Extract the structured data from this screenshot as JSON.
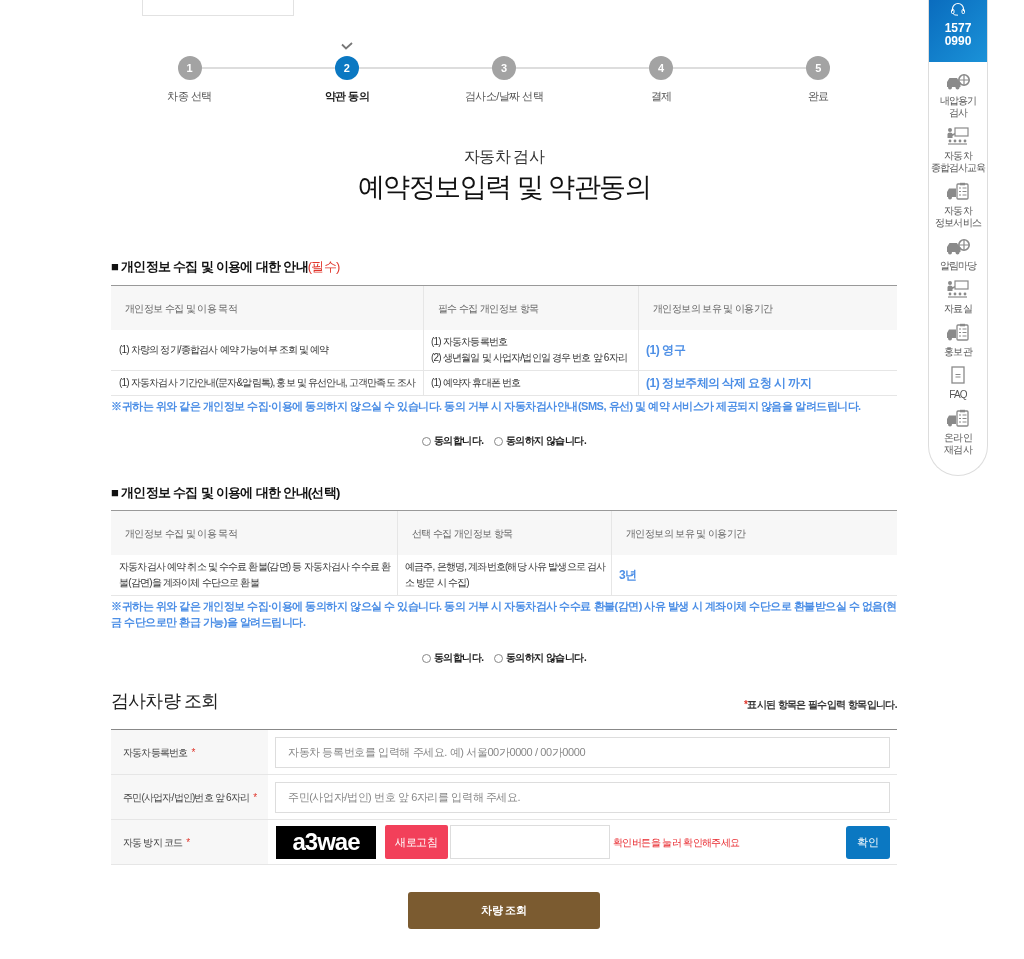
{
  "stepper": {
    "steps": [
      {
        "number": "1",
        "label": "차종 선택",
        "selected": false
      },
      {
        "number": "2",
        "label": "약관 동의",
        "selected": true
      },
      {
        "number": "3",
        "label": "검사소/날짜 선택",
        "selected": false
      },
      {
        "number": "4",
        "label": "결제",
        "selected": false
      },
      {
        "number": "5",
        "label": "완료",
        "selected": false
      }
    ]
  },
  "heading": {
    "subtitle": "자동차 검사",
    "title": "예약정보입력 및 약관동의"
  },
  "consent_sections": [
    {
      "title": "■ 개인정보 수집 및 이용에 대한 안내",
      "tag": "(필수)",
      "columns": [
        {
          "label": "개인정보 수집 및 이용 목적",
          "highlight": false
        },
        {
          "label": "필수 수집 개인정보 항목",
          "highlight": false
        },
        {
          "label": "개인정보의 보유 및 이용기간",
          "highlight": true
        }
      ],
      "rows": [
        {
          "cells": [
            [
              "(1) 차량의 정기/종합검사 예약 가능여부 조회 및 예약"
            ],
            [
              "(1) 자동차등록번호",
              "(2) 생년월일 및 사업자/법인일 경우 번호 앞 6자리"
            ],
            [
              "(1) 영구"
            ]
          ]
        },
        {
          "cells": [
            [
              "(1) 자동차검사 기간안내(문자&알림톡), 홍보 및 유선안내, 고객만족도 조사"
            ],
            [
              "(1) 예약자 휴대폰 번호"
            ],
            [
              "(1) 정보주체의 삭제 요청 시 까지"
            ]
          ]
        }
      ],
      "notice": "※귀하는 위와 같은 개인정보 수집·이용에 동의하지 않으실 수 있습니다. 동의 거부 시 자동차검사안내(SMS, 유선) 및 예약 서비스가 제공되지 않음을 알려드립니다.",
      "options": [
        {
          "label": "동의합니다.",
          "selected": false
        },
        {
          "label": "동의하지 않습니다.",
          "selected": false
        }
      ]
    },
    {
      "title": "■ 개인정보 수집 및 이용에 대한 안내(선택)",
      "columns": [
        {
          "label": "개인정보 수집 및 이용 목적",
          "highlight": false
        },
        {
          "label": "선택 수집 개인정보 항목",
          "highlight": false
        },
        {
          "label": "개인정보의 보유 및 이용기간",
          "highlight": true
        }
      ],
      "rows": [
        {
          "cells": [
            [
              "자동차검사 예약 취소 및 수수료 환불(감면) 등 자동차검사 수수료 환불(감면)을 계좌이체 수단으로 환불"
            ],
            [
              "예금주, 은행명, 계좌번호(해당 사유 발생으로 검사소 방문 시 수집)"
            ],
            [
              "3년"
            ]
          ]
        }
      ],
      "notice": "※귀하는 위와 같은 개인정보 수집·이용에 동의하지 않으실 수 있습니다. 동의 거부 시 자동차검사 수수료 환불(감면) 사유 발생 시 계좌이체 수단으로 환불받으실 수 없음(현금 수단으로만 환급 가능)을 알려드립니다.",
      "options": [
        {
          "label": "동의합니다.",
          "selected": false
        },
        {
          "label": "동의하지 않습니다.",
          "selected": false
        }
      ]
    }
  ],
  "vehicle_lookup": {
    "title": "검사차량 조회",
    "note_mark": "*",
    "note": "표시된 항목은 필수입력 항목입니다.",
    "fields": [
      {
        "kind": "text",
        "label": "자동차등록번호",
        "required_mark": "*",
        "placeholder": "자동차 등록번호를 입력해 주세요. 예) 서울00가0000 / 00가0000"
      },
      {
        "kind": "text",
        "label": "주민(사업자/법인)번호 앞 6자리",
        "required_mark": "*",
        "placeholder": "주민(사업자/법인) 번호 앞 6자리를 입력해 주세요."
      },
      {
        "kind": "captcha",
        "label": "자동 방지 코드",
        "required_mark": "*",
        "captcha_text": "a3wae",
        "refresh_button": "새로고침",
        "message": "확인버튼을 눌러 확인해주세요",
        "confirm_button": "확인"
      }
    ],
    "submit_button": "차량 조회"
  },
  "quick_menu": {
    "phone": [
      "1577",
      "0990"
    ],
    "items": [
      {
        "lines": [
          "내압용기",
          "검사"
        ]
      },
      {
        "lines": [
          "자동차",
          "종합검사교육"
        ]
      },
      {
        "lines": [
          "자동차",
          "정보서비스"
        ]
      },
      {
        "lines": [
          "알림마당"
        ]
      },
      {
        "lines": [
          "자료실"
        ]
      },
      {
        "lines": [
          "홍보관"
        ]
      },
      {
        "lines": [
          "FAQ"
        ]
      },
      {
        "lines": [
          "온라인",
          "재검사"
        ]
      }
    ]
  }
}
